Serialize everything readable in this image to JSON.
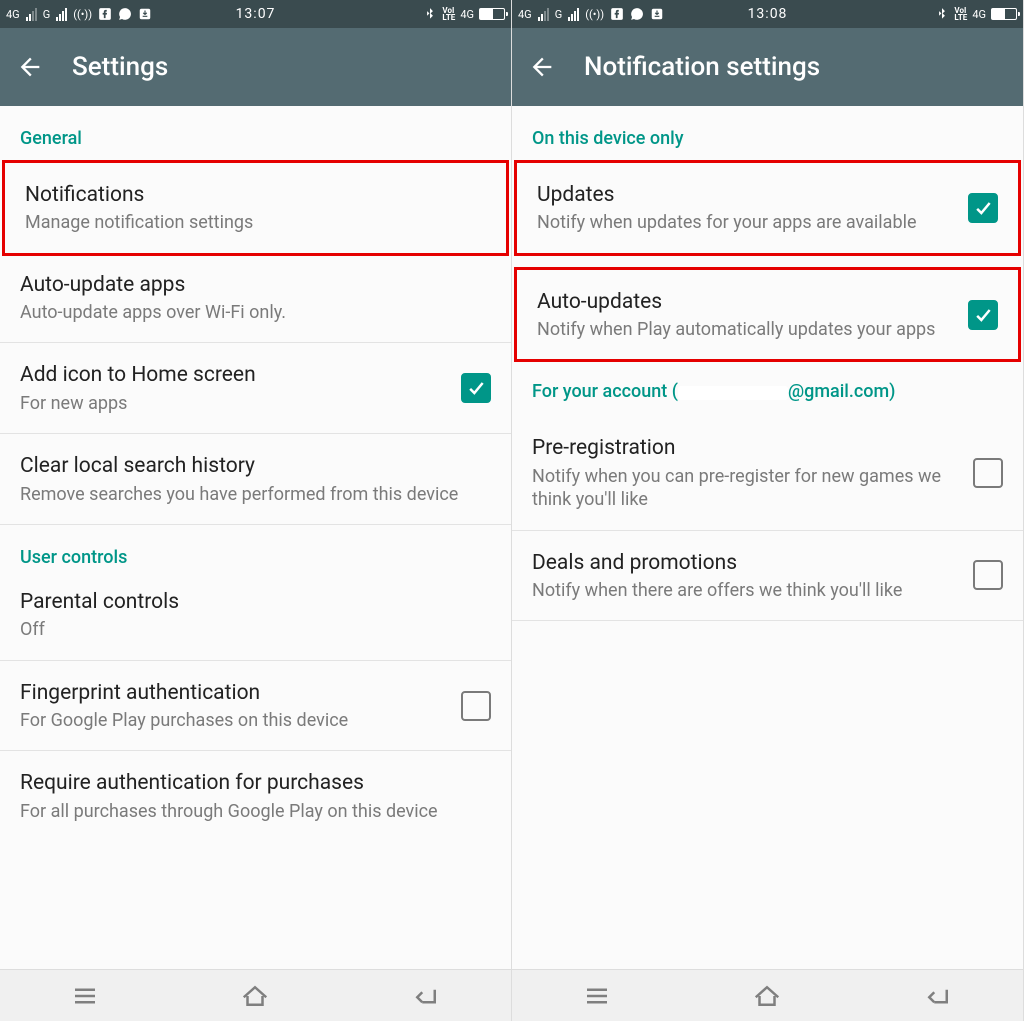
{
  "left": {
    "status": {
      "net1": "4G",
      "net2": "G",
      "time": "13:07",
      "lte": "4G"
    },
    "appbar": {
      "title": "Settings"
    },
    "sections": {
      "general_label": "General",
      "notifications": {
        "title": "Notifications",
        "sub": "Manage notification settings"
      },
      "autoupdate": {
        "title": "Auto-update apps",
        "sub": "Auto-update apps over Wi-Fi only."
      },
      "addicon": {
        "title": "Add icon to Home screen",
        "sub": "For new apps"
      },
      "clear": {
        "title": "Clear local search history",
        "sub": "Remove searches you have performed from this device"
      },
      "user_label": "User controls",
      "parental": {
        "title": "Parental controls",
        "sub": "Off"
      },
      "fingerprint": {
        "title": "Fingerprint authentication",
        "sub": "For Google Play purchases on this device"
      },
      "require": {
        "title": "Require authentication for purchases",
        "sub": "For all purchases through Google Play on this device"
      }
    }
  },
  "right": {
    "status": {
      "net1": "4G",
      "net2": "G",
      "time": "13:08",
      "lte": "4G"
    },
    "appbar": {
      "title": "Notification settings"
    },
    "sections": {
      "device_label": "On this device only",
      "updates": {
        "title": "Updates",
        "sub": "Notify when updates for your apps are available"
      },
      "autoupdates": {
        "title": "Auto-updates",
        "sub": "Notify when Play automatically updates your apps"
      },
      "account_label_pre": "For your account (",
      "account_label_email": "@gmail.com)",
      "prereg": {
        "title": "Pre-registration",
        "sub": "Notify when you can pre-register for new games we think you'll like"
      },
      "deals": {
        "title": "Deals and promotions",
        "sub": "Notify when there are offers we think you'll like"
      }
    }
  }
}
